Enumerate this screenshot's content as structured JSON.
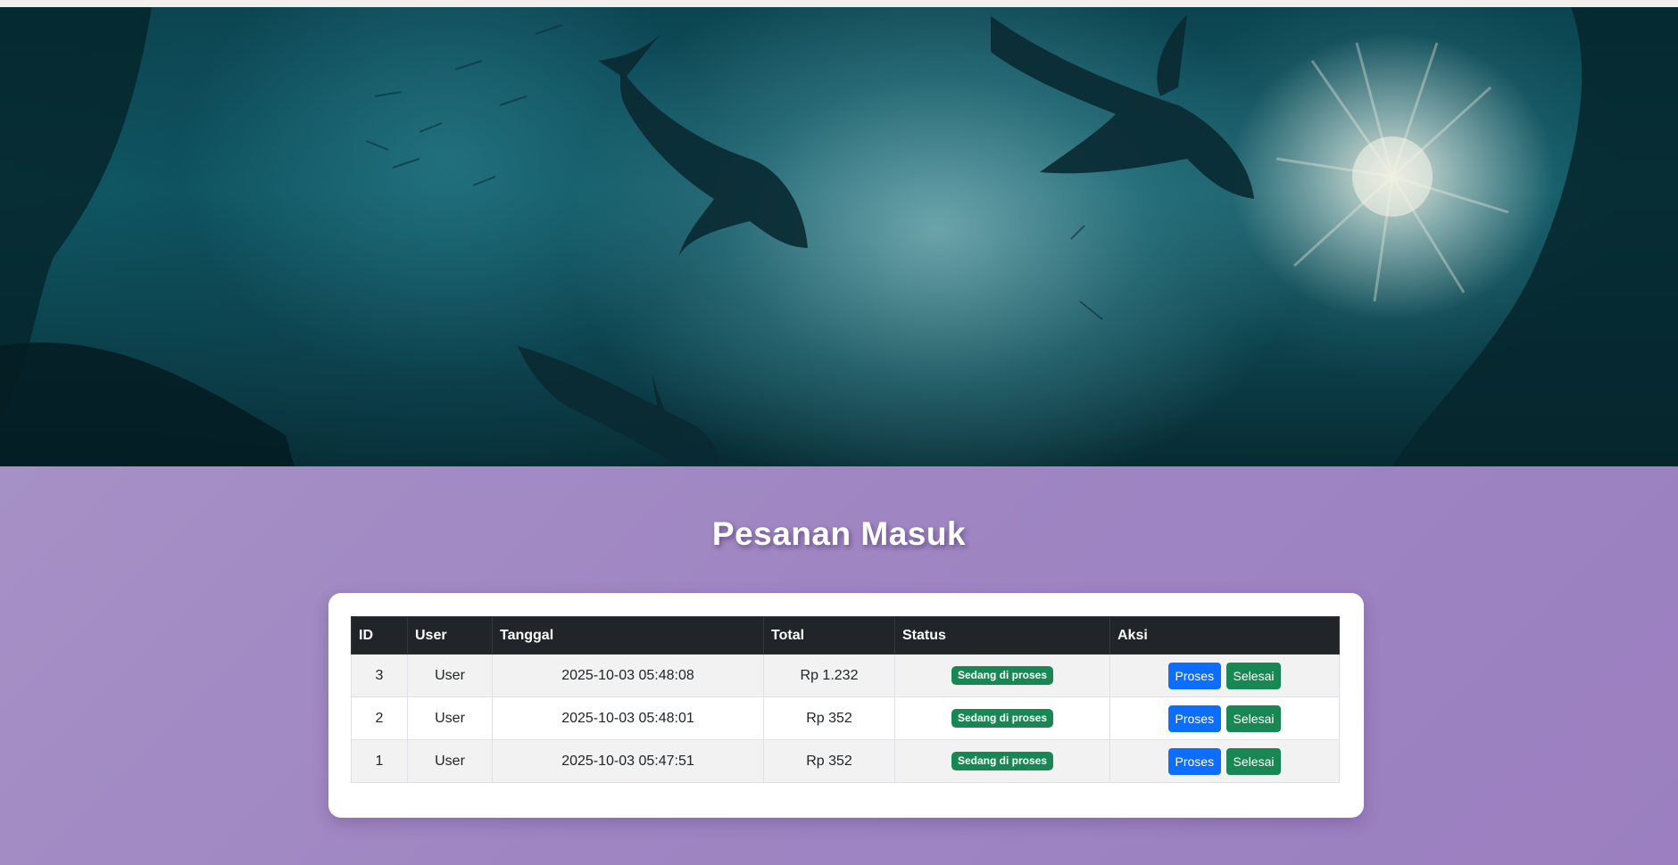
{
  "page": {
    "title": "Pesanan Masuk"
  },
  "hero": {
    "image": "underwater-sharks-banner"
  },
  "table": {
    "headers": {
      "id": "ID",
      "user": "User",
      "date": "Tanggal",
      "total": "Total",
      "status": "Status",
      "action": "Aksi"
    },
    "rows": [
      {
        "id": "3",
        "user": "User",
        "date": "2025-10-03 05:48:08",
        "total": "Rp 1.232",
        "status": "Sedang di proses",
        "process_label": "Proses",
        "done_label": "Selesai"
      },
      {
        "id": "2",
        "user": "User",
        "date": "2025-10-03 05:48:01",
        "total": "Rp 352",
        "status": "Sedang di proses",
        "process_label": "Proses",
        "done_label": "Selesai"
      },
      {
        "id": "1",
        "user": "User",
        "date": "2025-10-03 05:47:51",
        "total": "Rp 352",
        "status": "Sedang di proses",
        "process_label": "Proses",
        "done_label": "Selesai"
      }
    ]
  },
  "colors": {
    "background_start": "#a995c6",
    "background_end": "#9b7fc0",
    "table_header": "#212529",
    "badge_success": "#198754",
    "button_primary": "#0d6efd",
    "button_success": "#198754"
  }
}
